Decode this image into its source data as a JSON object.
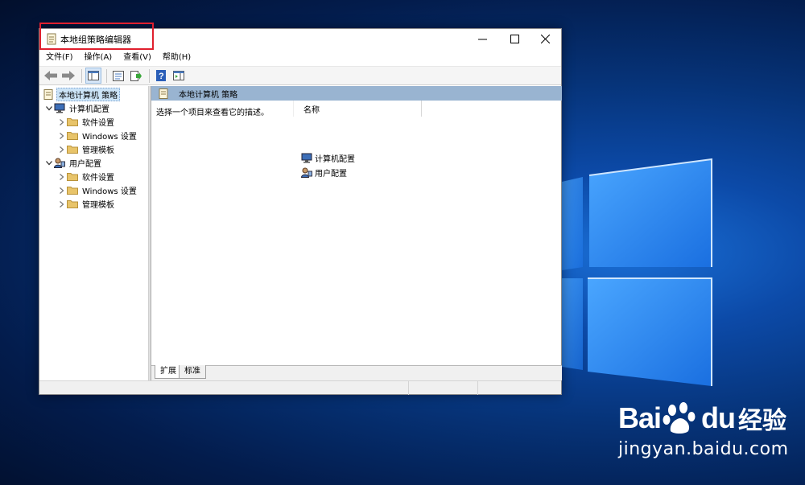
{
  "window": {
    "title": "本地组策略编辑器"
  },
  "menu": [
    "文件(F)",
    "操作(A)",
    "查看(V)",
    "帮助(H)"
  ],
  "tree": {
    "root": "本地计算机 策略",
    "computer": {
      "label": "计算机配置",
      "children": [
        "软件设置",
        "Windows 设置",
        "管理模板"
      ]
    },
    "user": {
      "label": "用户配置",
      "children": [
        "软件设置",
        "Windows 设置",
        "管理模板"
      ]
    }
  },
  "right_pane": {
    "header": "本地计算机 策略",
    "description": "选择一个项目来查看它的描述。",
    "column_name": "名称",
    "items": [
      "计算机配置",
      "用户配置"
    ]
  },
  "tabs": [
    "扩展",
    "标准"
  ],
  "watermark": {
    "brand_left": "Bai",
    "brand_right": "du",
    "product": "经验",
    "url": "jingyan.baidu.com"
  },
  "colors": {
    "selection_header": "#99b4d1",
    "highlight_box": "#e0202e",
    "folder": "#e8c46a"
  }
}
